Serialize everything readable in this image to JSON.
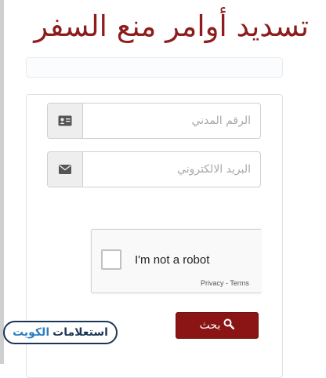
{
  "header": {
    "title": "تسديد أوامر منع السفر"
  },
  "form": {
    "civil_id": {
      "placeholder": "الرقم المدني",
      "value": "",
      "icon": "id-card-icon"
    },
    "email": {
      "placeholder": "البريد الالكتروني",
      "value": "",
      "icon": "envelope-icon"
    },
    "captcha": {
      "label": "I'm not a robot",
      "privacy": "Privacy",
      "separator": " - ",
      "terms": "Terms"
    },
    "search_button": {
      "label": "بحث",
      "icon": "search-icon"
    }
  },
  "brand": {
    "part1": "استعلامات",
    "part2": "الكويت"
  },
  "colors": {
    "accent": "#8b1515",
    "title": "#8e1c1c",
    "brand_dark": "#1d3657",
    "brand_light": "#2b7ec0"
  }
}
